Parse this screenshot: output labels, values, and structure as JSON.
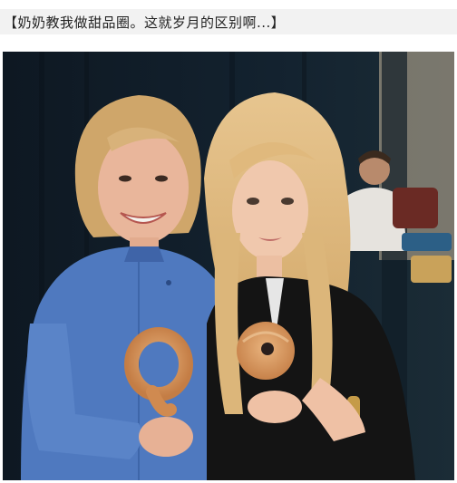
{
  "post": {
    "caption": "【奶奶教我做甜品圈。这就岁月的区别啊...】"
  },
  "photo": {
    "subjects": [
      "older-woman-blue-jacket",
      "young-woman-black-jacket",
      "background-man"
    ],
    "props": [
      "donut-bent-figure-eight",
      "donut-ring"
    ]
  }
}
